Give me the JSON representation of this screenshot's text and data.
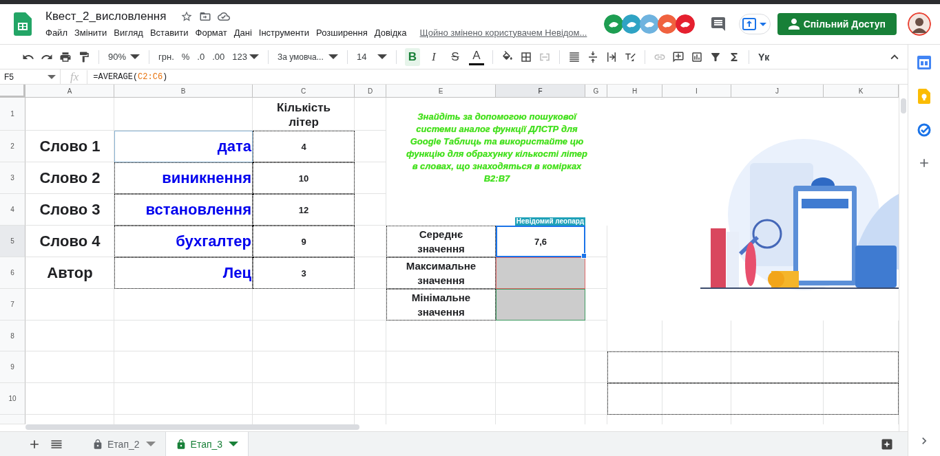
{
  "document": {
    "title": "Квест_2_висловлення",
    "last_edit": "Щойно змінено користувачем Невідом..."
  },
  "menu": [
    "Файл",
    "Змінити",
    "Вигляд",
    "Вставити",
    "Формат",
    "Дані",
    "Інструменти",
    "Розширення",
    "Довідка"
  ],
  "collaborators": [
    {
      "color": "#1e9e52"
    },
    {
      "color": "#2fa3c4"
    },
    {
      "color": "#6fb3df"
    },
    {
      "color": "#f0623f"
    },
    {
      "color": "#e5202f"
    }
  ],
  "share_button": "Спільний Доступ",
  "toolbar": {
    "zoom": "90%",
    "currency": "грн.",
    "percent": "%",
    "decrease_decimals": ".0",
    "increase_decimals": ".00",
    "number_format": "123",
    "font": "За умовча...",
    "font_size": "14",
    "format_buttons": [
      {
        "kind": "bold",
        "glyph": "B",
        "selected": true
      },
      {
        "kind": "italic",
        "glyph": "I",
        "selected": false
      },
      {
        "kind": "strikethrough",
        "glyph": "S",
        "selected": false
      },
      {
        "kind": "text_color",
        "glyph": "A",
        "selected": false
      }
    ],
    "input_tools": "Yк"
  },
  "formula_bar": {
    "name_box": "F5",
    "fx": "fx",
    "formula_prefix": "=AVERAGE(",
    "formula_range": "C2:C6",
    "formula_suffix": ")"
  },
  "columns": [
    {
      "label": "A",
      "selected": false
    },
    {
      "label": "B",
      "selected": false
    },
    {
      "label": "C",
      "selected": false
    },
    {
      "label": "D",
      "selected": false
    },
    {
      "label": "E",
      "selected": false
    },
    {
      "label": "F",
      "selected": true
    },
    {
      "label": "G",
      "selected": false
    },
    {
      "label": "H",
      "selected": false
    },
    {
      "label": "I",
      "selected": false
    },
    {
      "label": "J",
      "selected": false
    },
    {
      "label": "K",
      "selected": false
    }
  ],
  "rows": [
    {
      "label": "1",
      "selected": false
    },
    {
      "label": "2",
      "selected": false
    },
    {
      "label": "3",
      "selected": false
    },
    {
      "label": "4",
      "selected": false
    },
    {
      "label": "5",
      "selected": true
    },
    {
      "label": "6",
      "selected": false
    },
    {
      "label": "7",
      "selected": false
    },
    {
      "label": "8",
      "selected": false
    },
    {
      "label": "9",
      "selected": false
    },
    {
      "label": "10",
      "selected": false
    }
  ],
  "word_table": {
    "count_header": "Кількість літер",
    "rows": [
      {
        "label": "Слово 1",
        "word": "дата",
        "count": "4"
      },
      {
        "label": "Слово 2",
        "word": "виникнення",
        "count": "10"
      },
      {
        "label": "Слово 3",
        "word": "встановлення",
        "count": "12"
      },
      {
        "label": "Слово 4",
        "word": "бухгалтер",
        "count": "9"
      },
      {
        "label": "Автор",
        "word": "Лец",
        "count": "3"
      }
    ]
  },
  "instruction": "Знайдіть за допомогою пошукової системи аналог функції ДЛСТР для Google Таблиць та використайте цю функцію для обрахунку кількості літер в словах, що знаходяться в комірках B2:B7",
  "collaborator_flag": {
    "name": "Невідомий леопард",
    "color": "#1fa1b8"
  },
  "stats_table": [
    {
      "label": "Середнє значення",
      "value": "7,6",
      "shaded": false
    },
    {
      "label": "Максимальне значення",
      "shaded": true
    },
    {
      "label": "Мінімальне значення",
      "shaded": true
    }
  ],
  "collaborator_selections": [
    {
      "color": "#8ab4d4"
    },
    {
      "color": "#e06666"
    },
    {
      "color": "#3c9a5f"
    }
  ],
  "sheet_tabs": [
    {
      "label": "Етап_2",
      "selected": false
    },
    {
      "label": "Етап_3",
      "selected": true
    }
  ]
}
